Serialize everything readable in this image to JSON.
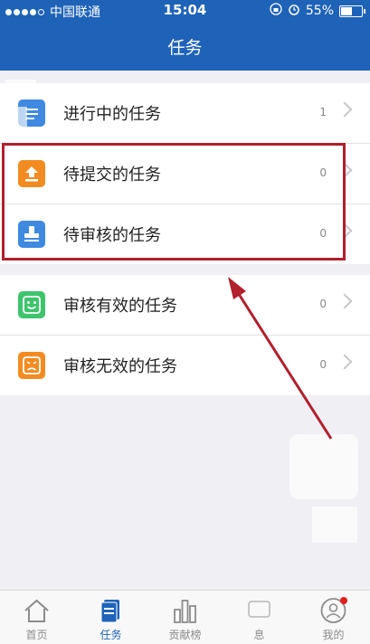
{
  "status": {
    "carrier": "中国联通",
    "time": "15:04",
    "battery": "55%"
  },
  "header": {
    "title": "任务"
  },
  "tasks": {
    "group1": [
      {
        "label": "进行中的任务",
        "count": "1",
        "color": "#3f8ae0",
        "icon": "in-progress-icon"
      },
      {
        "label": "待提交的任务",
        "count": "0",
        "color": "#f28c22",
        "icon": "upload-icon"
      },
      {
        "label": "待审核的任务",
        "count": "0",
        "color": "#3f8ae0",
        "icon": "stamp-icon"
      }
    ],
    "group2": [
      {
        "label": "审核有效的任务",
        "count": "0",
        "color": "#3ec46d",
        "icon": "smile-icon"
      },
      {
        "label": "审核无效的任务",
        "count": "0",
        "color": "#f28c22",
        "icon": "sad-icon"
      }
    ]
  },
  "tabs": [
    {
      "label": "首页",
      "icon": "home-icon"
    },
    {
      "label": "任务",
      "icon": "task-icon",
      "active": true
    },
    {
      "label": "贡献榜",
      "icon": "ranking-icon"
    },
    {
      "label": "息",
      "icon": "message-icon"
    },
    {
      "label": "我的",
      "icon": "profile-icon"
    }
  ],
  "colors": {
    "primary": "#1f63b8",
    "highlight": "#b21f2d"
  }
}
